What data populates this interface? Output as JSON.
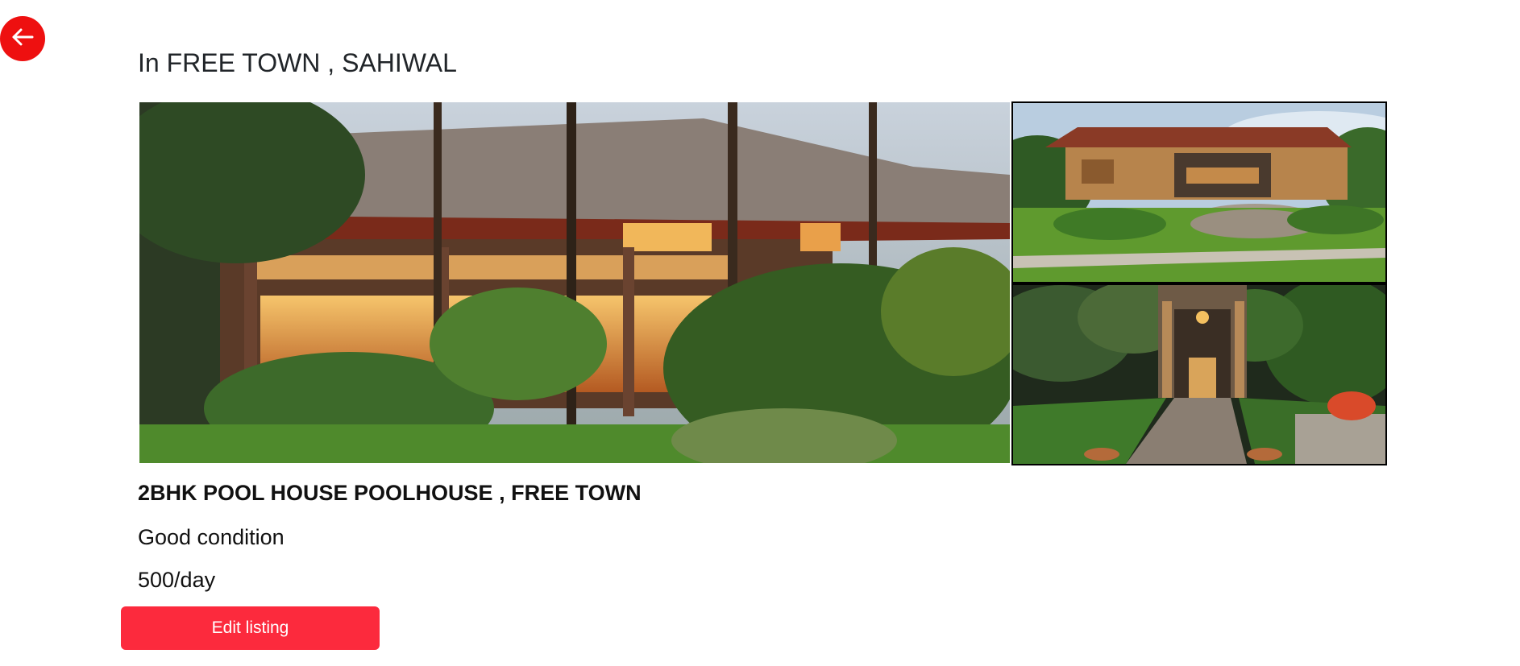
{
  "nav": {
    "back_icon": "arrow-left-icon",
    "back_color": "#ee1010"
  },
  "listing": {
    "location_heading": "In FREE TOWN , SAHIWAL",
    "title": "2BHK POOL HOUSE POOLHOUSE , FREE TOWN",
    "condition": "Good condition",
    "price": "500/day",
    "edit_button_label": "Edit listing",
    "edit_button_color": "#fc2a3d"
  },
  "gallery": {
    "photo_count": 3
  }
}
